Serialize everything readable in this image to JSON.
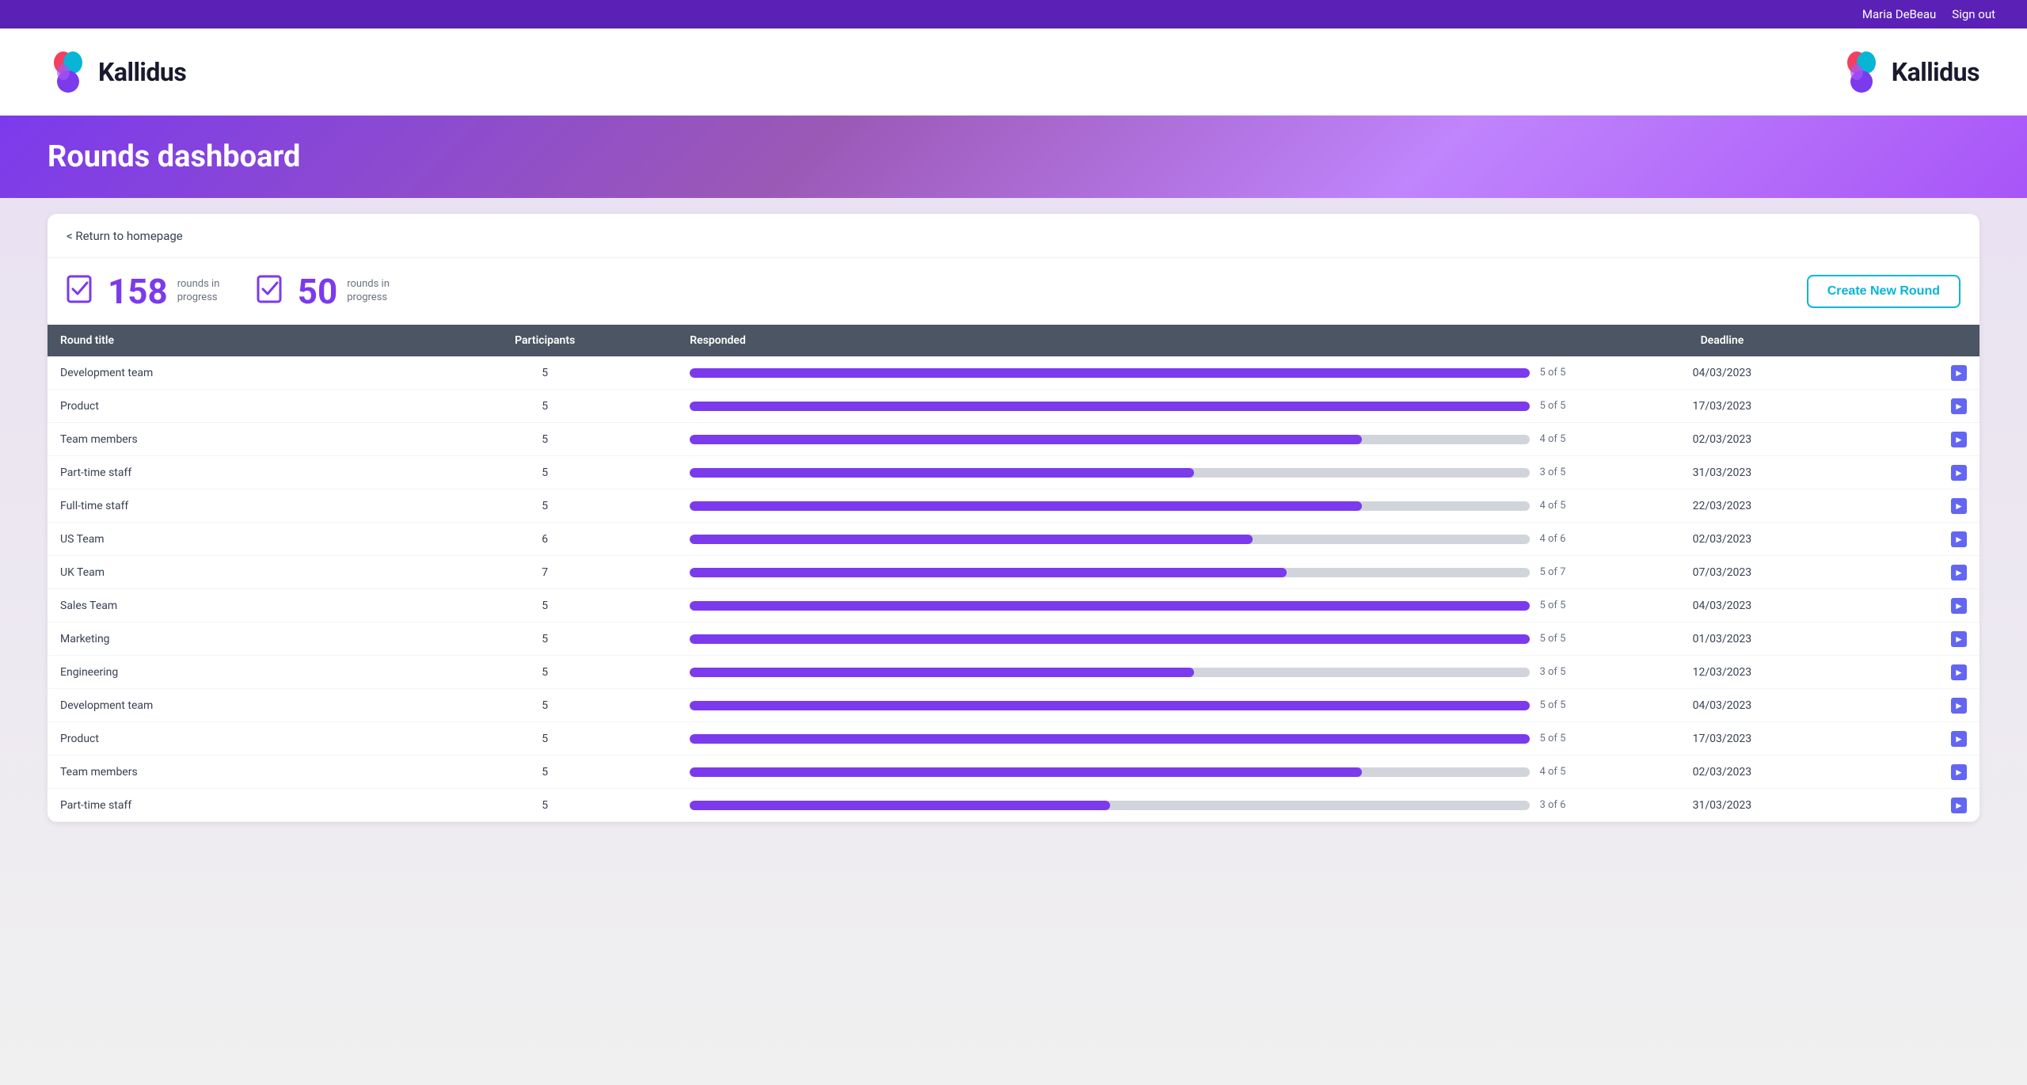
{
  "topbar": {
    "username": "Maria DeBeau",
    "signout_label": "Sign out"
  },
  "header": {
    "logo_text": "Kallidus",
    "logo_text_right": "Kallidus"
  },
  "hero": {
    "title": "Rounds dashboard"
  },
  "navigation": {
    "return_link": "< Return to homepage"
  },
  "stats": {
    "stat1_number": "158",
    "stat1_label": "rounds in progress",
    "stat2_number": "50",
    "stat2_label": "rounds in progress",
    "create_button": "Create New Round"
  },
  "table": {
    "columns": [
      "Round title",
      "Participants",
      "Responded",
      "Deadline"
    ],
    "rows": [
      {
        "title": "Development team",
        "participants": 5,
        "responded": 5,
        "total": 5,
        "progress": 100,
        "deadline": "04/03/2023"
      },
      {
        "title": "Product",
        "participants": 5,
        "responded": 5,
        "total": 5,
        "progress": 100,
        "deadline": "17/03/2023"
      },
      {
        "title": "Team members",
        "participants": 5,
        "responded": 4,
        "total": 5,
        "progress": 80,
        "deadline": "02/03/2023"
      },
      {
        "title": "Part-time staff",
        "participants": 5,
        "responded": 3,
        "total": 5,
        "progress": 60,
        "deadline": "31/03/2023"
      },
      {
        "title": "Full-time staff",
        "participants": 5,
        "responded": 4,
        "total": 5,
        "progress": 80,
        "deadline": "22/03/2023"
      },
      {
        "title": "US Team",
        "participants": 6,
        "responded": 4,
        "total": 6,
        "progress": 67,
        "deadline": "02/03/2023"
      },
      {
        "title": "UK Team",
        "participants": 7,
        "responded": 5,
        "total": 7,
        "progress": 71,
        "deadline": "07/03/2023"
      },
      {
        "title": "Sales Team",
        "participants": 5,
        "responded": 5,
        "total": 5,
        "progress": 100,
        "deadline": "04/03/2023"
      },
      {
        "title": "Marketing",
        "participants": 5,
        "responded": 5,
        "total": 5,
        "progress": 100,
        "deadline": "01/03/2023"
      },
      {
        "title": "Engineering",
        "participants": 5,
        "responded": 3,
        "total": 5,
        "progress": 60,
        "deadline": "12/03/2023"
      },
      {
        "title": "Development team",
        "participants": 5,
        "responded": 5,
        "total": 5,
        "progress": 100,
        "deadline": "04/03/2023"
      },
      {
        "title": "Product",
        "participants": 5,
        "responded": 5,
        "total": 5,
        "progress": 100,
        "deadline": "17/03/2023"
      },
      {
        "title": "Team members",
        "participants": 5,
        "responded": 4,
        "total": 5,
        "progress": 80,
        "deadline": "02/03/2023"
      },
      {
        "title": "Part-time staff",
        "participants": 5,
        "responded": 3,
        "total": 6,
        "progress": 50,
        "deadline": "31/03/2023"
      }
    ]
  },
  "colors": {
    "purple_accent": "#7c3aed",
    "header_bg": "#4b5563",
    "progress_fill": "#7c3aed",
    "progress_bg": "#d1d5db",
    "hero_gradient_start": "#7c3aed",
    "hero_gradient_end": "#c084fc",
    "cyan_button": "#06b6d4"
  }
}
